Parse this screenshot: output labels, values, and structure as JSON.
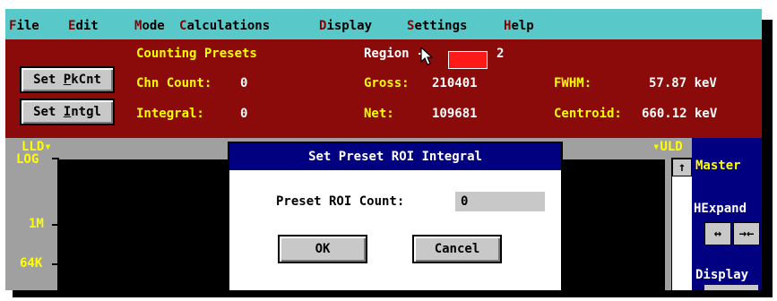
{
  "menu": [
    {
      "hotkey": "F",
      "rest": "ile"
    },
    {
      "hotkey": "E",
      "rest": "dit"
    },
    {
      "hotkey": "M",
      "rest": "ode"
    },
    {
      "hotkey": "C",
      "rest": "alculations"
    },
    {
      "hotkey": "D",
      "rest": "isplay"
    },
    {
      "hotkey": "S",
      "rest": "ettings"
    },
    {
      "hotkey": "H",
      "rest": "elp"
    }
  ],
  "info": {
    "counting_presets": "Counting Presets",
    "chn_count_label": "Chn Count:",
    "chn_count_value": "0",
    "integral_label": "Integral:",
    "integral_value": "0",
    "region_label": "Region -",
    "region_value": "2",
    "gross_label": "Gross:",
    "gross_value": "210401",
    "net_label": "Net:",
    "net_value": "109681",
    "fwhm_label": "FWHM:",
    "fwhm_value": "57.87 keV",
    "centroid_label": "Centroid:",
    "centroid_value": "660.12 keV",
    "region_color": "#ff1a1a"
  },
  "buttons": {
    "set_pkcnt": {
      "pre": "Set ",
      "hk": "P",
      "post": "kCnt"
    },
    "set_intgl": {
      "pre": "Set ",
      "hk": "I",
      "post": "ntgl"
    }
  },
  "plot": {
    "lld_label": "LLD▾",
    "uld_label": "▾ULD",
    "log_label": "LOG",
    "y_1m": "1M",
    "y_64k": "64K"
  },
  "right_panel": {
    "master": "Master",
    "hexpand": "HExpand",
    "expand_btn": "↔",
    "contract_btn": "→←",
    "display": "Display"
  },
  "scroll_up": "↑",
  "dialog": {
    "title": "Set Preset ROI Integral",
    "field_label": "Preset ROI Count:",
    "field_value": "0",
    "ok_label": "OK",
    "cancel_label": "Cancel"
  },
  "colors": {
    "menubar": "#58c8c8",
    "info_bg": "#8b0a0a",
    "label_yellow": "#ffff00",
    "dialog_title": "#000080"
  }
}
